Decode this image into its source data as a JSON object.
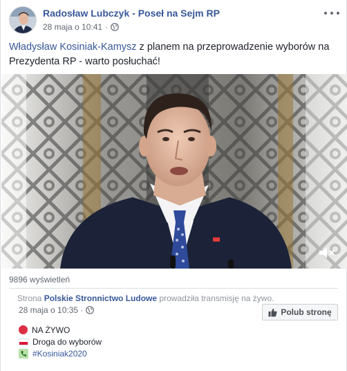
{
  "post": {
    "author": "Radosław Lubczyk - Poseł na Sejm RP",
    "timestamp": "28 maja o 10:41",
    "privacy_icon": "globe-icon",
    "more_icon": "more-options-icon",
    "text_mention": "Władysław Kosiniak-Kamysz",
    "text_rest": " z planem na przeprowadzenie wyborów na Prezydenta RP - warto posłuchać!"
  },
  "video": {
    "mute_icon": "speaker-muted-icon"
  },
  "views": "9896 wyświetleń",
  "shared": {
    "prefix": "Strona ",
    "page_name": "Polskie Stronnictwo Ludowe",
    "suffix": " prowadziła transmisję na żywo.",
    "timestamp": "28 maja o 10:35 · ",
    "like_button": "Polub stronę",
    "lines": [
      {
        "icon": "red-circle-icon",
        "text": "NA ŻYWO"
      },
      {
        "icon": "poland-flag-icon",
        "text": "Droga do wyborów"
      },
      {
        "icon": "phone-icon",
        "text": "#Kosiniak2020"
      }
    ]
  },
  "colors": {
    "link": "#385898",
    "secondary_text": "#606770",
    "border": "#dddfe2",
    "live_red": "#dd2e44"
  }
}
